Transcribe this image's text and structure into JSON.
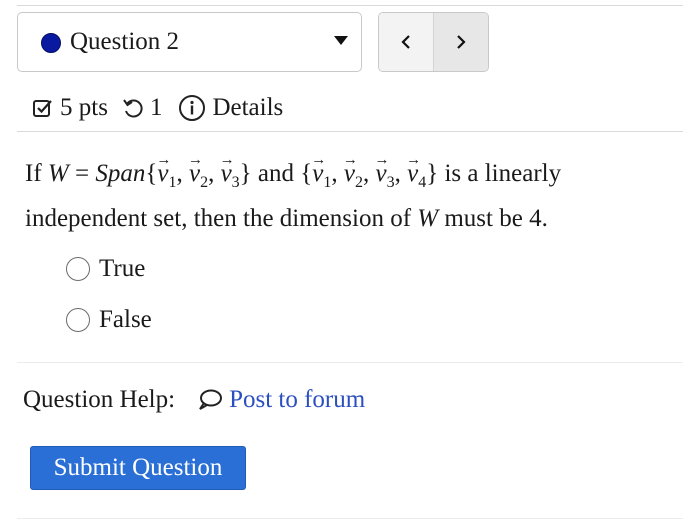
{
  "question_select": {
    "label": "Question 2",
    "icon": "chevron-down-icon",
    "status_color": "#0a1aa0"
  },
  "nav": {
    "prev_icon": "chevron-left-icon",
    "next_icon": "chevron-right-icon"
  },
  "meta": {
    "points": "5 pts",
    "attempts": "1",
    "details": "Details"
  },
  "question": {
    "if": "If",
    "W": "W",
    "eq": " = ",
    "span": "Span",
    "brace_open": "{",
    "brace_close": "}",
    "comma": ", ",
    "v": "v",
    "sub1": "1",
    "sub2": "2",
    "sub3": "3",
    "sub4": "4",
    "and": " and ",
    "text_after_set": " is a linearly independent set, then the dimension of ",
    "text_end": " must be 4."
  },
  "options": [
    {
      "label": "True",
      "selected": false
    },
    {
      "label": "False",
      "selected": false
    }
  ],
  "help": {
    "label": "Question Help:",
    "forum_link": "Post to forum"
  },
  "submit": {
    "label": "Submit Question",
    "color": "#2a6fd6"
  }
}
